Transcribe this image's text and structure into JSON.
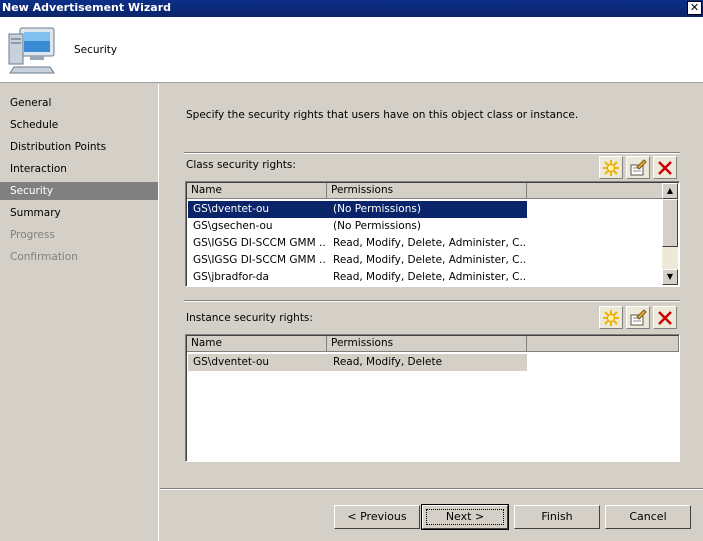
{
  "window": {
    "title": "New Advertisement Wizard",
    "close_glyph": "✕"
  },
  "header": {
    "title": "Security",
    "icon": "computer-icon"
  },
  "nav": {
    "items": [
      {
        "label": "General",
        "state": "normal"
      },
      {
        "label": "Schedule",
        "state": "normal"
      },
      {
        "label": "Distribution Points",
        "state": "normal"
      },
      {
        "label": "Interaction",
        "state": "normal"
      },
      {
        "label": "Security",
        "state": "selected"
      },
      {
        "label": "Summary",
        "state": "normal"
      },
      {
        "label": "Progress",
        "state": "disabled"
      },
      {
        "label": "Confirmation",
        "state": "disabled"
      }
    ]
  },
  "main": {
    "description": "Specify the security rights that users have on this object class or instance.",
    "class_rights": {
      "label": "Class security rights:",
      "columns": [
        "Name",
        "Permissions"
      ],
      "rows": [
        {
          "name": "GS\\dventet-ou",
          "permissions": "(No Permissions)"
        },
        {
          "name": "GS\\gsechen-ou",
          "permissions": "(No Permissions)"
        },
        {
          "name": "GS\\IGSG DI-SCCM GMM ...",
          "permissions": "Read, Modify, Delete, Administer, C..."
        },
        {
          "name": "GS\\IGSG DI-SCCM GMM ...",
          "permissions": "Read, Modify, Delete, Administer, C..."
        },
        {
          "name": "GS\\jbradfor-da",
          "permissions": "Read, Modify, Delete, Administer, C..."
        }
      ]
    },
    "instance_rights": {
      "label": "Instance security rights:",
      "columns": [
        "Name",
        "Permissions"
      ],
      "rows": [
        {
          "name": "GS\\dventet-ou",
          "permissions": "Read, Modify, Delete"
        }
      ]
    }
  },
  "buttons": {
    "previous": "< Previous",
    "next": "Next >",
    "finish": "Finish",
    "cancel": "Cancel"
  },
  "colors": {
    "selection_dark": "#0a246a",
    "title_bar": "#0a246a",
    "dialog_face": "#d4d0c8",
    "delete_red": "#cc0000"
  }
}
